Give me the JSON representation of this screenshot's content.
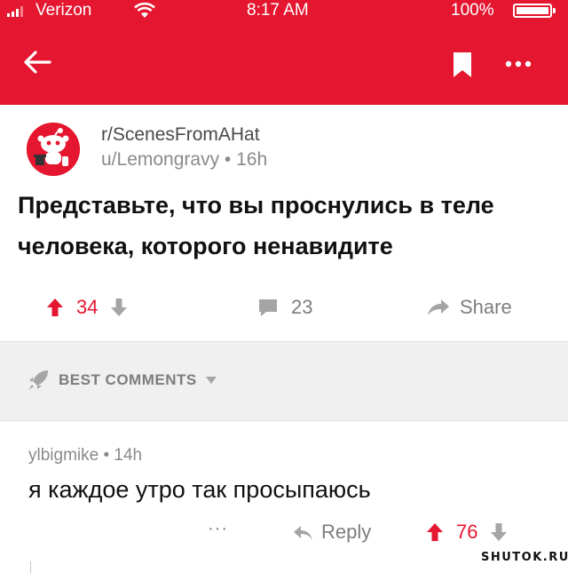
{
  "status_bar": {
    "carrier": "Verizon",
    "time": "8:17 AM",
    "battery_percent": "100%"
  },
  "header": {
    "background_color": "#e5162f",
    "icons": [
      "back-arrow-icon",
      "bookmark-icon",
      "more-options-icon"
    ]
  },
  "post": {
    "subreddit": "r/ScenesFromAHat",
    "author_line": "u/Lemongravy • 16h",
    "title": "Представьте, что вы проснулись в теле человека, которого ненавидите",
    "upvotes": "34",
    "comments": "23",
    "share_label": "Share",
    "upvote_color": "#e5162f"
  },
  "sort": {
    "label": "BEST COMMENTS"
  },
  "comment": {
    "author_line": "ylbigmike • 14h",
    "body": "я каждое утро так просыпаюсь",
    "more_label": "···",
    "reply_label": "Reply",
    "upvotes": "76"
  },
  "watermark": "SHUTOK.RU"
}
